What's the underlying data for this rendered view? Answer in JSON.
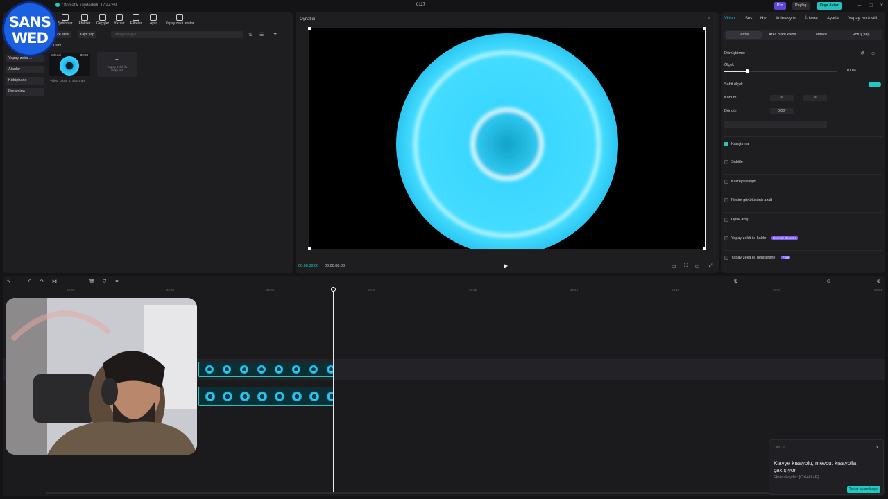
{
  "titlebar": {
    "autosave": "Otomatik kaydedildi: 17:44:59",
    "project": "0117",
    "pro": "Pro",
    "share": "Paylaş",
    "export": "Dışa Aktar"
  },
  "logo": {
    "line1": "SANS",
    "line2": "WED"
  },
  "media": {
    "tools": [
      "Şablonlar",
      "Efektler",
      "Geçişler",
      "Yazılar",
      "Filtreler",
      "Ayar",
      "Yapay zekâ avatar"
    ],
    "import": "İçe aktar",
    "record": "Kayıt yap",
    "search_placeholder": "Medya arayın",
    "sidebar": [
      "Yapay zekâ ...",
      "Alanlar",
      "Kütüphane",
      "Dreamina"
    ],
    "section": "Tümü",
    "clip": {
      "added": "Eklendi",
      "duration": "00:08",
      "name": "Video_Okay_1_Size.mp4"
    },
    "ai_card": "Yapay zekâ ile oluşturun"
  },
  "player": {
    "title": "Oynatıcı",
    "time_current": "00:00:08:00",
    "time_total": "00:00:08:00"
  },
  "inspector": {
    "tabs": [
      "Video",
      "Ses",
      "Hız",
      "Animasyon",
      "İzleme",
      "Ayarla",
      "Yapay zekâ stili"
    ],
    "subtabs": [
      "Temel",
      "Arka planı kaldır",
      "Maske",
      "Rötuş yap"
    ],
    "transform": "Dönüştürme",
    "scale_label": "Ölçek",
    "scale_value": "100%",
    "uniform_scale": "Sabit ölçek",
    "position_label": "Konum",
    "pos_x": "0",
    "pos_y": "0",
    "rotate_label": "Döndür",
    "rotate_value": "0.00°",
    "blend": "Karıştırma",
    "features": [
      "Sabitle",
      "Kaliteyi iyileştir",
      "Resim gürültüsünü azalt",
      "Optik akış",
      "Yapay zekâ ile kaldır",
      "Yapay zekâ ile genişletme"
    ],
    "badge_try": "Ücretsiz deneme",
    "badge_free": "Free"
  },
  "timeline": {
    "ticks": [
      "00:00",
      "00:03",
      "00:06",
      "00:09",
      "00:12",
      "00:15",
      "00:18",
      "00:21",
      "00:24"
    ]
  },
  "toast": {
    "app": "CapCut",
    "title": "Klavye kısayolu, mevcut kısayolla çakışıyor",
    "detail": "Ekranı kaydet: [Ctrl+Alt+P]",
    "button": "Tekrar bulanıklaştır"
  },
  "colors": {
    "accent": "#22c7c2",
    "brand_blue": "#1a60e0",
    "badge_purple": "#7d5cff"
  }
}
